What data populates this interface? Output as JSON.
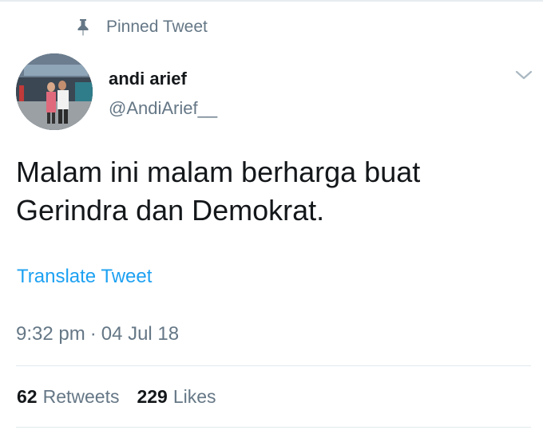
{
  "pinned": {
    "label": "Pinned Tweet",
    "icon": "pin-icon"
  },
  "author": {
    "name": "andi arief",
    "handle": "@AndiArief__"
  },
  "tweet": {
    "text": "Malam ini malam berharga buat\nGerindra dan Demokrat.",
    "translate_label": "Translate Tweet",
    "time": "9:32 pm",
    "separator": "·",
    "date": "04 Jul 18"
  },
  "stats": {
    "retweets_count": "62",
    "retweets_label": "Retweets",
    "likes_count": "229",
    "likes_label": "Likes"
  },
  "colors": {
    "link": "#1da1f2",
    "secondary_text": "#657786",
    "primary_text": "#14171a",
    "divider": "#e1e8ed"
  }
}
